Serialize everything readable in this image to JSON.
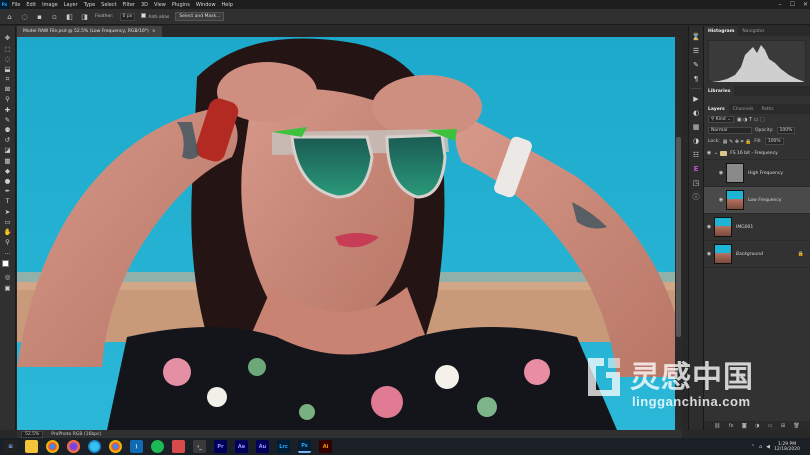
{
  "menubar": {
    "app_icon": "Ps",
    "items": [
      "File",
      "Edit",
      "Image",
      "Layer",
      "Type",
      "Select",
      "Filter",
      "3D",
      "View",
      "Plugins",
      "Window",
      "Help"
    ]
  },
  "options": {
    "feather_label": "Feather:",
    "feather_value": "0 px",
    "antialias_label": "Anti-alias",
    "select_mask_label": "Select and Mask..."
  },
  "document": {
    "tab_title": "Model RAW File.psd @ 52.5% (Low Frequency, RGB/16*)",
    "tab_close": "×"
  },
  "statusbar": {
    "zoom": "52.5%",
    "profile": "ProPhoto RGB (16bpc)"
  },
  "panels": {
    "top_tabs": [
      "Histogram",
      "Navigator"
    ],
    "libraries_label": "Libraries",
    "layer_tabs": [
      "Layers",
      "Channels",
      "Paths"
    ],
    "kind_label": "Kind",
    "blend_mode": "Normal",
    "opacity_label": "Opacity:",
    "opacity_value": "100%",
    "lock_label": "Lock:",
    "fill_label": "Fill:",
    "fill_value": "100%",
    "layers": [
      {
        "name": "FS 16 bit - Frequency",
        "type": "group"
      },
      {
        "name": "High Frequency",
        "type": "gray"
      },
      {
        "name": "Low Frequency",
        "type": "photo",
        "selected": true
      },
      {
        "name": "IMG001",
        "type": "photo"
      },
      {
        "name": "Background",
        "type": "photo"
      }
    ],
    "footer_icons": [
      "link-icon",
      "fx-icon",
      "mask-icon",
      "adjustment-icon",
      "folder-icon",
      "new-layer-icon",
      "trash-icon"
    ]
  },
  "taskbar": {
    "apps": [
      "Explorer",
      "Chrome",
      "Firefox",
      "Edge",
      "VS Code",
      "Spotify",
      "Terminal",
      "Pr",
      "Ae",
      "Au",
      "Lrc",
      "Ps",
      "Ai"
    ],
    "time": "1:29 PM",
    "date": "12/18/2020"
  },
  "watermark": {
    "chinese": "灵感中国",
    "url": "lingganchina.com"
  },
  "colors": {
    "ui_dark": "#282828",
    "panel": "#323232",
    "ps_blue": "#31a8ff",
    "sky": "#1fb2d2"
  }
}
